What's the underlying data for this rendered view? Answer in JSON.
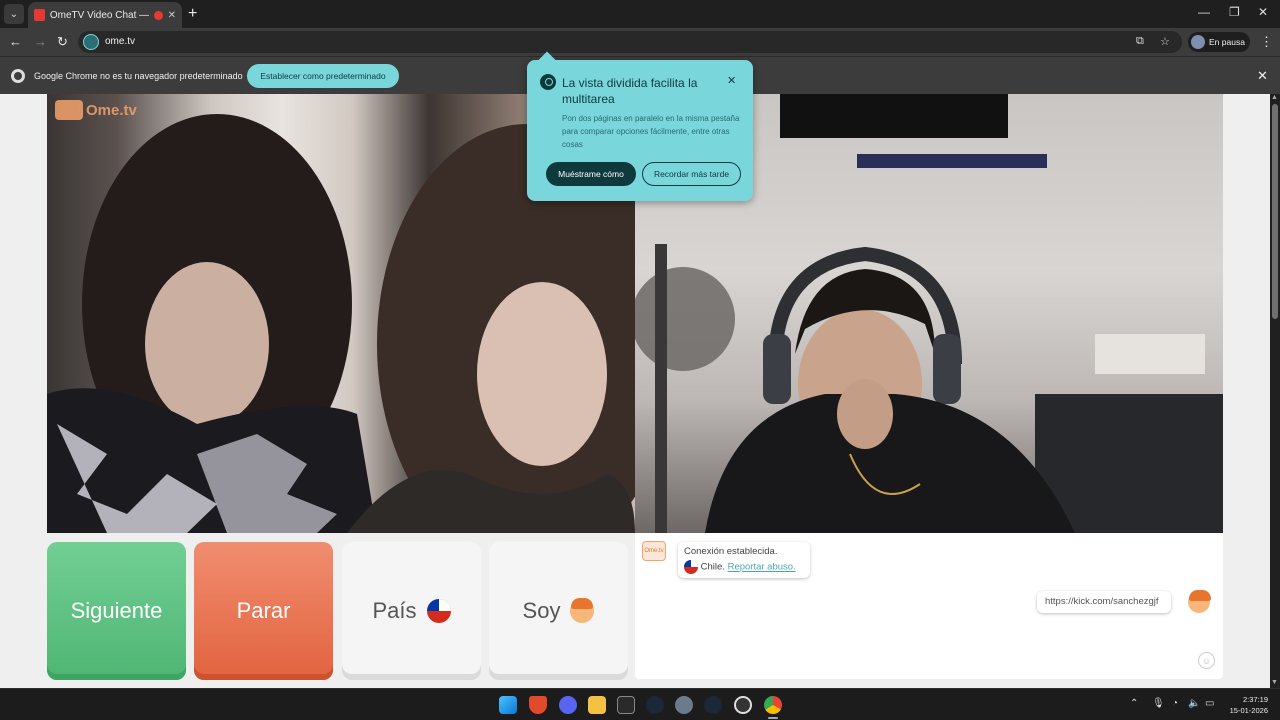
{
  "browser": {
    "tab_title": "OmeTV Video Chat — Ome",
    "url": "ome.tv",
    "profile_label": "En pausa"
  },
  "infobar": {
    "message": "Google Chrome no es tu navegador predeterminado",
    "button": "Establecer como predeterminado"
  },
  "popup": {
    "title": "La vista dividida facilita la multitarea",
    "body": "Pon dos páginas en paralelo en la misma pestaña para comparar opciones fácilmente, entre otras cosas",
    "primary_button": "Muéstrame cómo",
    "secondary_button": "Recordar más tarde"
  },
  "site": {
    "brand": "Ome.tv"
  },
  "controls": {
    "next": "Siguiente",
    "stop": "Parar",
    "country": "País",
    "me": "Soy"
  },
  "chat": {
    "logo_text": "Ome.tv",
    "status": "Conexión establecida.",
    "country": "Chile.",
    "report": "Reportar abuso.",
    "message": "https://kick.com/sanchezgjf"
  },
  "taskbar": {
    "time": "2:37:19",
    "date": "15-01-2026"
  },
  "colors": {
    "next_button": "#5cc27f",
    "stop_button": "#e8704b",
    "accent_teal": "#79d7dc"
  }
}
